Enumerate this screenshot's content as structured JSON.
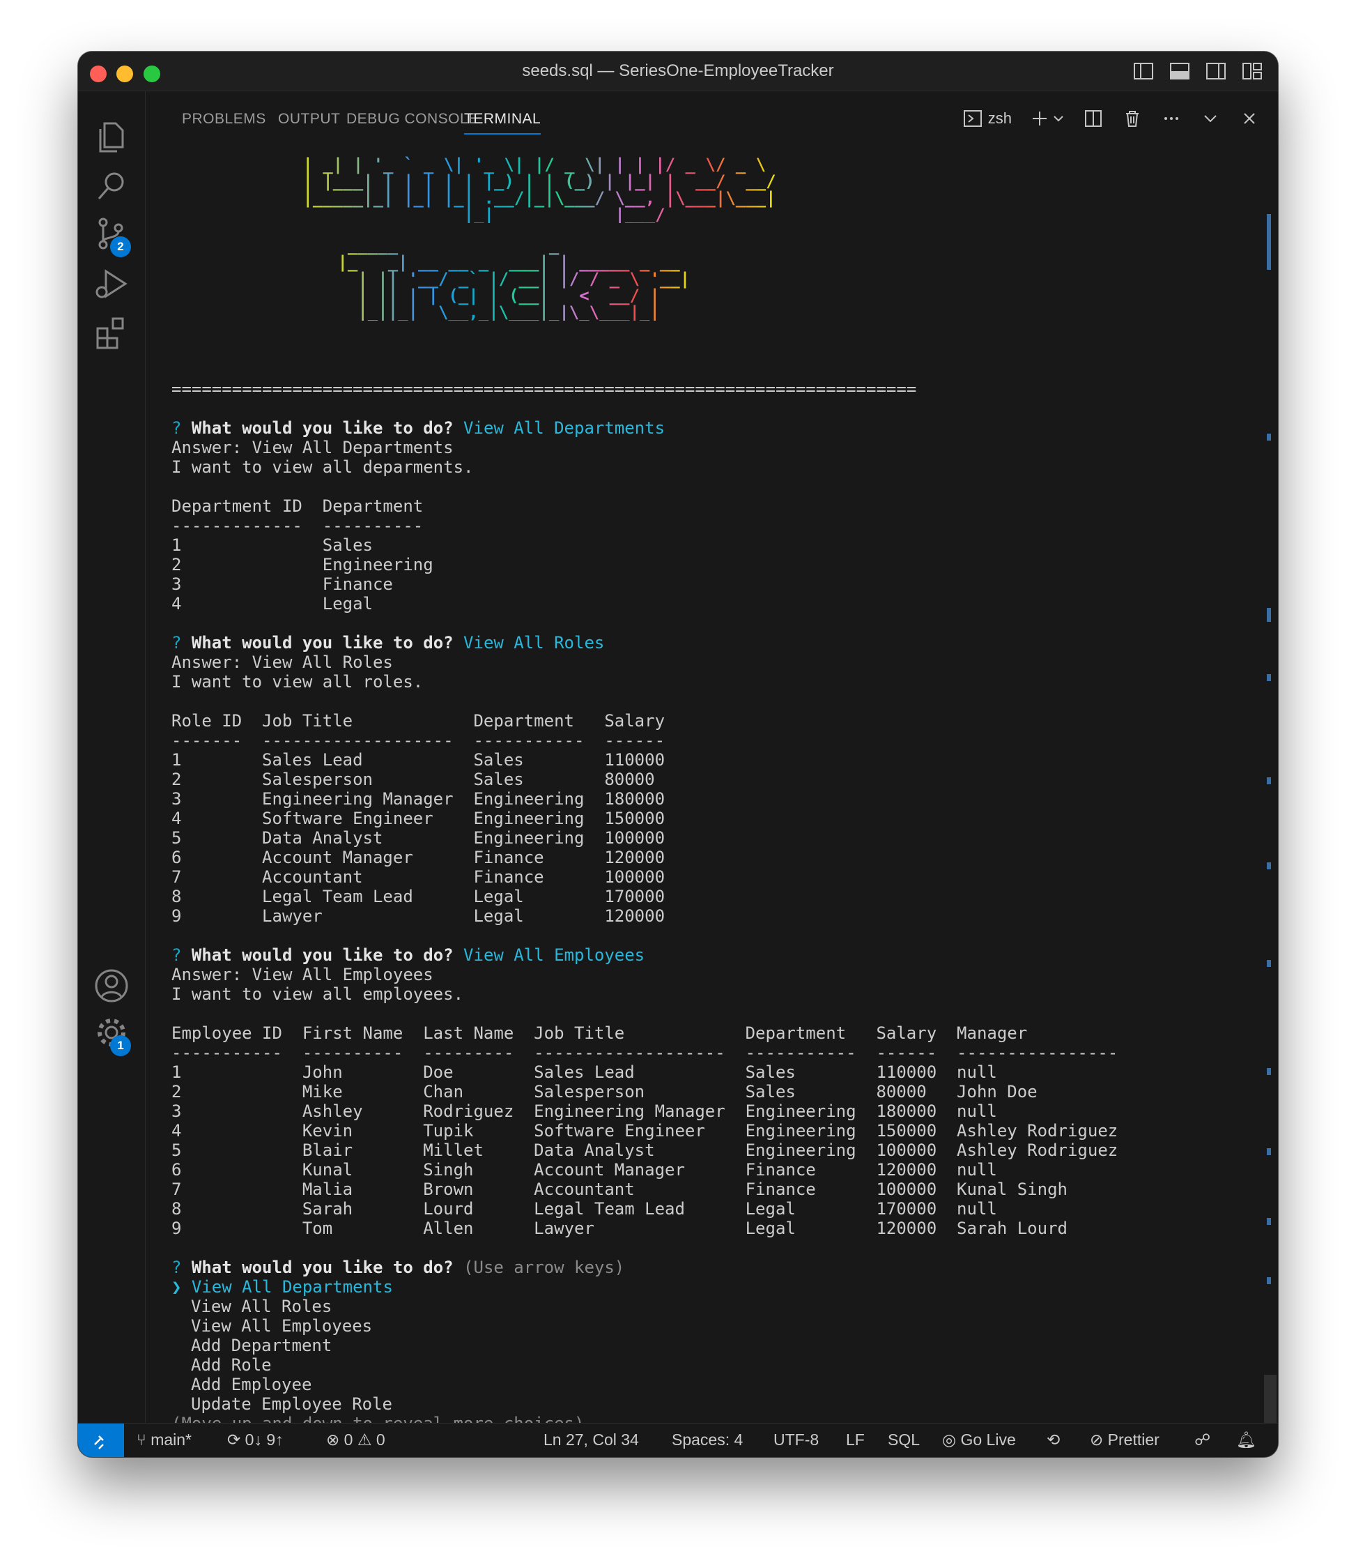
{
  "window": {
    "title": "seeds.sql — SeriesOne-EmployeeTracker"
  },
  "activity": {
    "scm_badge": "2",
    "settings_badge": "1"
  },
  "panel": {
    "tabs": [
      "PROBLEMS",
      "OUTPUT",
      "DEBUG CONSOLE",
      "TERMINAL"
    ],
    "active_tab": "TERMINAL",
    "shell": "zsh"
  },
  "terminal": {
    "ascii_line1": " | _| | '_ ` _ \\| '_ \\| |/ _ \\| | | |/ _ \\/ _ \\\n | |___| | | | | | |_) | | (_) | |_| |  __/  __/\n |_____|_| |_| |_| .__/|_|\\___/ \\__, |\\___|\\___|\n                 |_|            |___/",
    "ascii_line2": "  _____               _\n |_   _| __ __ _  ___| | _____ _ __\n   | || '__/ _` |/ __| |/ / _ \\ '__|\n   | || | | (_| | (__|   <  __/ |\n   |_||_|  \\__,_|\\___|_|\\_\\___|_|",
    "separator": "==========================================================================",
    "prompt_mark": "?",
    "question": "What would you like to do?",
    "blocks": [
      {
        "answer_choice": "View All Departments",
        "answer_line": "Answer: View All Departments",
        "want_line": "I want to view all deparments.",
        "table_lines": [
          "Department ID  Department",
          "-------------  ----------",
          "1              Sales",
          "2              Engineering",
          "3              Finance",
          "4              Legal"
        ]
      },
      {
        "answer_choice": "View All Roles",
        "answer_line": "Answer: View All Roles",
        "want_line": "I want to view all roles.",
        "table_lines": [
          "Role ID  Job Title            Department   Salary",
          "-------  -------------------  -----------  ------",
          "1        Sales Lead           Sales        110000",
          "2        Salesperson          Sales        80000",
          "3        Engineering Manager  Engineering  180000",
          "4        Software Engineer    Engineering  150000",
          "5        Data Analyst         Engineering  100000",
          "6        Account Manager      Finance      120000",
          "7        Accountant           Finance      100000",
          "8        Legal Team Lead      Legal        170000",
          "9        Lawyer               Legal        120000"
        ]
      },
      {
        "answer_choice": "View All Employees",
        "answer_line": "Answer: View All Employees",
        "want_line": "I want to view all employees.",
        "table_lines": [
          "Employee ID  First Name  Last Name  Job Title            Department   Salary  Manager",
          "-----------  ----------  ---------  -------------------  -----------  ------  ----------------",
          "1            John        Doe        Sales Lead           Sales        110000  null",
          "2            Mike        Chan       Salesperson          Sales        80000   John Doe",
          "3            Ashley      Rodriguez  Engineering Manager  Engineering  180000  null",
          "4            Kevin       Tupik      Software Engineer    Engineering  150000  Ashley Rodriguez",
          "5            Blair       Millet     Data Analyst         Engineering  100000  Ashley Rodriguez",
          "6            Kunal       Singh      Account Manager      Finance      120000  null",
          "7            Malia       Brown      Accountant           Finance      100000  Kunal Singh",
          "8            Sarah       Lourd      Legal Team Lead      Legal        170000  null",
          "9            Tom         Allen      Lawyer               Legal        120000  Sarah Lourd"
        ]
      }
    ],
    "final_hint": "(Use arrow keys)",
    "menu_pointer": "❯",
    "menu_selected": "View All Departments",
    "menu_items": [
      "View All Roles",
      "View All Employees",
      "Add Department",
      "Add Role",
      "Add Employee",
      "Update Employee Role"
    ],
    "more_hint": "(Move up and down to reveal more choices)"
  },
  "status": {
    "branch": "main*",
    "sync": "0↓ 9↑",
    "errors": "0",
    "warnings": "0",
    "position": "Ln 27, Col 34",
    "spaces": "Spaces: 4",
    "encoding": "UTF-8",
    "eol": "LF",
    "language": "SQL",
    "golive": "Go Live",
    "prettier": "Prettier"
  }
}
